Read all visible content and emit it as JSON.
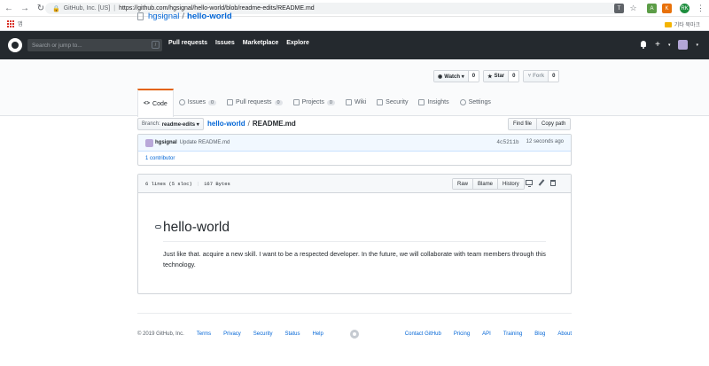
{
  "browser": {
    "site_identity": "GitHub, Inc. [US]",
    "url": "https://github.com/hgsignal/hello-world/blob/readme-edits/README.md",
    "apps_label": "앱",
    "other_bookmarks": "기타 북마크",
    "profile_initials": "RK"
  },
  "header": {
    "search_placeholder": "Search or jump to...",
    "search_key": "/",
    "nav": [
      "Pull requests",
      "Issues",
      "Marketplace",
      "Explore"
    ],
    "plus": "+",
    "caret": "▾"
  },
  "repo": {
    "owner": "hgsignal",
    "separator": "/",
    "name": "hello-world",
    "watch_label": "Watch ▾",
    "watch_count": "0",
    "star_label": "Star",
    "star_count": "0",
    "fork_label": "Fork",
    "fork_count": "0"
  },
  "reponav": {
    "code": "Code",
    "issues": "Issues",
    "issues_count": "0",
    "pulls": "Pull requests",
    "pulls_count": "0",
    "projects": "Projects",
    "projects_count": "0",
    "wiki": "Wiki",
    "security": "Security",
    "insights": "Insights",
    "settings": "Settings"
  },
  "file_nav": {
    "branch_label": "Branch:",
    "branch_value": "readme-edits ▾",
    "breadcrumb_repo": "hello-world",
    "breadcrumb_sep": "/",
    "breadcrumb_file": "README.md",
    "find_file": "Find file",
    "copy_path": "Copy path"
  },
  "commit": {
    "author": "hgsignal",
    "message": "Update README.md",
    "sha": "4c5211b",
    "time": "12 seconds ago",
    "contributors": "1 contributor"
  },
  "file": {
    "lines": "6 lines (5 sloc)",
    "size": "167 Bytes",
    "raw": "Raw",
    "blame": "Blame",
    "history": "History"
  },
  "readme": {
    "heading": "hello-world",
    "body": "Just like that. acquire a new skill. I want to be a respected developer. In the future, we will collaborate with team members through this technology."
  },
  "footer": {
    "copyright": "© 2019 GitHub, Inc.",
    "left_links": [
      "Terms",
      "Privacy",
      "Security",
      "Status",
      "Help"
    ],
    "right_links": [
      "Contact GitHub",
      "Pricing",
      "API",
      "Training",
      "Blog",
      "About"
    ]
  }
}
